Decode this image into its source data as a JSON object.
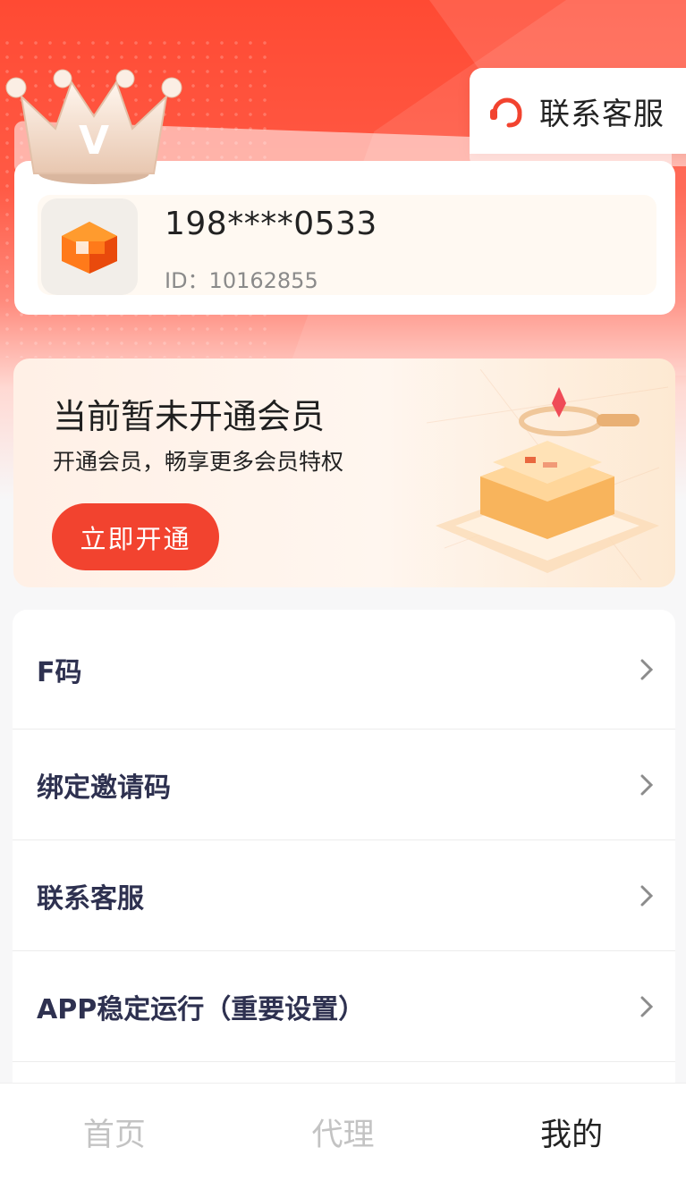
{
  "header": {
    "service_button_label": "联系客服"
  },
  "user": {
    "phone": "198****0533",
    "id_text": "ID：10162855"
  },
  "membership": {
    "title": "当前暂未开通会员",
    "subtitle": "开通会员，畅享更多会员特权",
    "button_label": "立即开通"
  },
  "menu": {
    "items": [
      {
        "label": "F码"
      },
      {
        "label": "绑定邀请码"
      },
      {
        "label": "联系客服"
      },
      {
        "label": "APP稳定运行（重要设置）"
      }
    ]
  },
  "tabbar": {
    "tabs": [
      {
        "label": "首页",
        "active": false
      },
      {
        "label": "代理",
        "active": false
      },
      {
        "label": "我的",
        "active": true
      }
    ]
  },
  "colors": {
    "brand_red": "#f2432f",
    "menu_text": "#2e3150"
  }
}
